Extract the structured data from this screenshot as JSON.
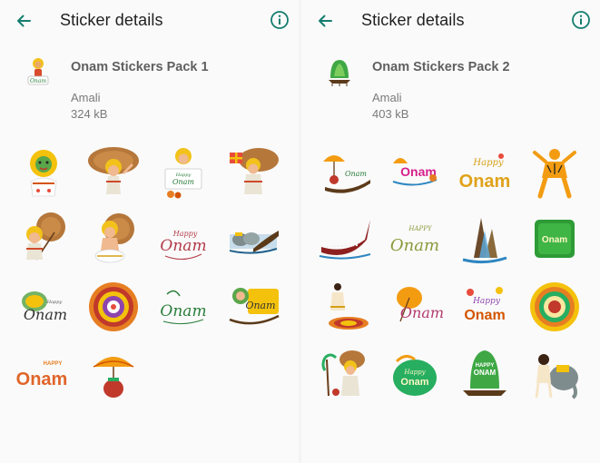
{
  "colors": {
    "accent_teal": "#147d6f",
    "title_text": "#1f1f1f",
    "pack_name_text": "#5f5f5f",
    "meta_text": "#7a7a7a",
    "background": "#fafafa"
  },
  "panels": [
    {
      "header": {
        "title": "Sticker details",
        "back_icon": "arrow-left-icon",
        "info_icon": "info-circle-icon"
      },
      "pack": {
        "name": "Onam Stickers Pack 1",
        "author": "Amali",
        "size": "324 kB"
      },
      "stickers": [
        {
          "type": "kathakali-face"
        },
        {
          "type": "mahabali-umbrella"
        },
        {
          "type": "mahabali-happy-onam-sign",
          "text_top": "Happy",
          "text_bottom": "Onam"
        },
        {
          "type": "mahabali-gift"
        },
        {
          "type": "mahabali-umbrella-left"
        },
        {
          "type": "mahabali-sitting"
        },
        {
          "type": "happy-onam-script",
          "text_top": "Happy",
          "text_bottom": "Onam"
        },
        {
          "type": "elephants-boat"
        },
        {
          "type": "onam-script-green",
          "text_top": "Happy",
          "text_bottom": "Onam"
        },
        {
          "type": "pookalam-flower"
        },
        {
          "type": "onam-script-green-2",
          "text_bottom": "Onam"
        },
        {
          "type": "kathakali-boat-script",
          "text_bottom": "Onam"
        },
        {
          "type": "happy-onam-orange",
          "text_top": "HAPPY",
          "text_bottom": "Onam"
        },
        {
          "type": "umbrella-pot"
        }
      ]
    },
    {
      "header": {
        "title": "Sticker details",
        "back_icon": "arrow-left-icon",
        "info_icon": "info-circle-icon"
      },
      "pack": {
        "name": "Onam Stickers Pack 2",
        "author": "Amali",
        "size": "403 kB"
      },
      "stickers": [
        {
          "type": "umbrella-boat",
          "text_bottom": "Onam"
        },
        {
          "type": "onam-pink-boat",
          "text_bottom": "Onam"
        },
        {
          "type": "happy-onam-gold",
          "text_top": "Happy",
          "text_bottom": "Onam"
        },
        {
          "type": "tiger-dance"
        },
        {
          "type": "snake-boat"
        },
        {
          "type": "happy-onam-green-script",
          "text_top": "HAPPY",
          "text_bottom": "Onam"
        },
        {
          "type": "waterfall-boats"
        },
        {
          "type": "onam-green-square",
          "text_bottom": "Onam"
        },
        {
          "type": "dancer-rangoli"
        },
        {
          "type": "umbrella-onam-script",
          "text_bottom": "Onam"
        },
        {
          "type": "happy-onam-flowers",
          "text_top": "Happy",
          "text_bottom": "Onam"
        },
        {
          "type": "pookalam-yellow"
        },
        {
          "type": "mahabali-palm"
        },
        {
          "type": "happy-onam-leaf",
          "text_top": "Happy",
          "text_bottom": "Onam"
        },
        {
          "type": "happy-onam-green-leaf",
          "text_top": "HAPPY",
          "text_bottom": "ONAM"
        },
        {
          "type": "elephant-kathakali"
        }
      ]
    }
  ]
}
